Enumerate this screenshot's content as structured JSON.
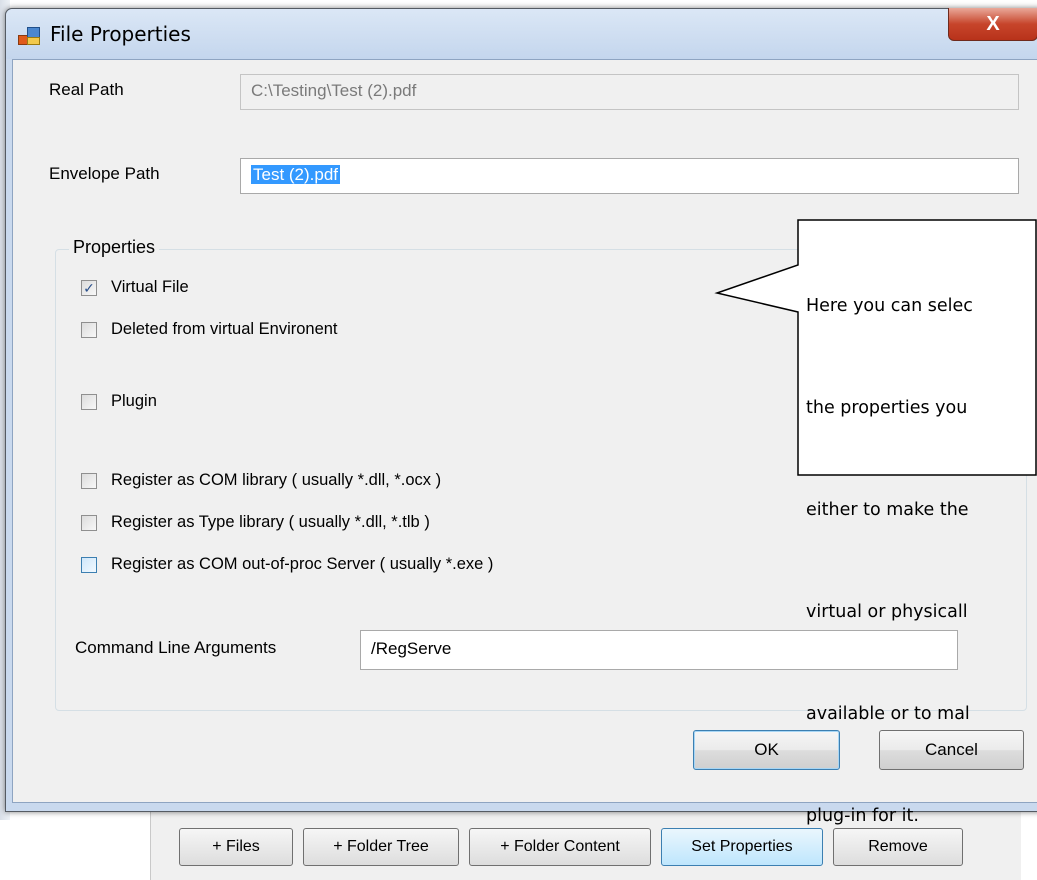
{
  "window": {
    "title": "File Properties",
    "close_glyph": "X"
  },
  "fields": {
    "real_path_label": "Real Path",
    "real_path_value": "C:\\Testing\\Test (2).pdf",
    "envelope_path_label": "Envelope Path",
    "envelope_path_value": "Test (2).pdf"
  },
  "properties": {
    "group_title": "Properties",
    "checkboxes": [
      {
        "label": "Virtual File",
        "checked": true
      },
      {
        "label": "Deleted from virtual Environent",
        "checked": false
      },
      {
        "label": "Plugin",
        "checked": false
      },
      {
        "label": "Register as COM library ( usually *.dll, *.ocx )",
        "checked": false
      },
      {
        "label": "Register as Type library ( usually *.dll, *.tlb )",
        "checked": false
      },
      {
        "label": "Register as COM out-of-proc Server ( usually *.exe )",
        "checked": false
      }
    ],
    "command_line_label": "Command Line Arguments",
    "command_line_value": "/RegServe"
  },
  "buttons": {
    "ok": "OK",
    "cancel": "Cancel"
  },
  "callout": {
    "lines": [
      "Here you can selec",
      "the properties you",
      "either to make the",
      "virtual or physicall",
      "available or to mal",
      "plug-in for it."
    ]
  },
  "background_toolbar": {
    "buttons": [
      "+ Files",
      "+ Folder Tree",
      "+ Folder Content",
      "Set Properties",
      "Remove"
    ]
  },
  "icons": {
    "app_icon": "properties-window-icon",
    "check_mark": "✓"
  }
}
